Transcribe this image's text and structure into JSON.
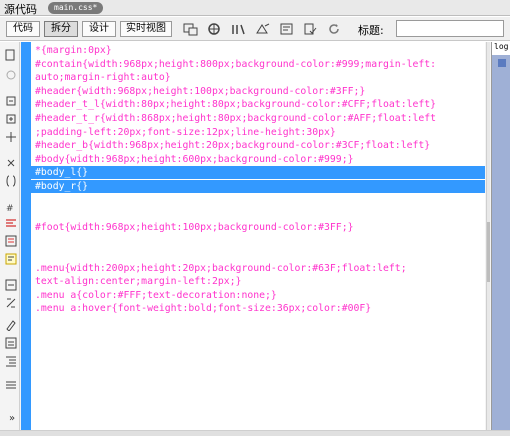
{
  "tabs": {
    "source_label": "源代码",
    "file_label": "main.css*"
  },
  "toolbar": {
    "buttons": [
      "代码",
      "拆分",
      "设计",
      "实时视图"
    ],
    "title_label": "标题:",
    "title_value": ""
  },
  "code": {
    "lines": [
      {
        "text": "*{margin:0px}",
        "selected": false
      },
      {
        "text": "#contain{width:968px;height:800px;background-color:#999;margin-left:",
        "selected": false
      },
      {
        "text": "auto;margin-right:auto}",
        "selected": false
      },
      {
        "text": "#header{width:968px;height:100px;background-color:#3FF;}",
        "selected": false
      },
      {
        "text": "#header_t_l{width:80px;height:80px;background-color:#CFF;float:left}",
        "selected": false
      },
      {
        "text": "#header_t_r{width:868px;height:80px;background-color:#AFF;float:left",
        "selected": false
      },
      {
        "text": ";padding-left:20px;font-size:12px;line-height:30px}",
        "selected": false
      },
      {
        "text": "#header_b{width:968px;height:20px;background-color:#3CF;float:left}",
        "selected": false
      },
      {
        "text": "#body{width:968px;height:600px;background-color:#999;}",
        "selected": false
      },
      {
        "text": "#body_l{}",
        "selected": true
      },
      {
        "text": "#body_r{}",
        "selected": true
      },
      {
        "text": "",
        "selected": false
      },
      {
        "text": "",
        "selected": false
      },
      {
        "text": "#foot{width:968px;height:100px;background-color:#3FF;}",
        "selected": false
      },
      {
        "text": "",
        "selected": false
      },
      {
        "text": "",
        "selected": false
      },
      {
        "text": ".menu{width:200px;height:20px;background-color:#63F;float:left;",
        "selected": false
      },
      {
        "text": "text-align:center;margin-left:2px;}",
        "selected": false
      },
      {
        "text": ".menu a{color:#FFF;text-decoration:none;}",
        "selected": false
      },
      {
        "text": ".menu a:hover{font-weight:bold;font-size:36px;color:#00F}",
        "selected": false
      }
    ]
  },
  "preview": {
    "text": "log"
  },
  "icons": {
    "toolbar": [
      "multiscreen-icon",
      "preview-globe-icon",
      "file-management-icon",
      "debug-icon",
      "visual-aids-icon",
      "validate-icon",
      "refresh-icon"
    ],
    "left_toolbar": [
      "open-documents-icon",
      "collapse-icon",
      "expand-tag-icon",
      "expand-all-icon",
      "select-parent-icon",
      "balance-braces-icon",
      "line-numbers-icon",
      "highlight-invalid-icon",
      "word-wrap-icon",
      "syntax-coloring-icon",
      "apply-comment-icon",
      "remove-comment-icon",
      "wrap-tag-icon",
      "recent-snippets-icon",
      "move-css-icon",
      "indent-icon",
      "format-source-icon"
    ]
  },
  "colors": {
    "selection": "#3399ff",
    "code_text": "#ff33cc"
  }
}
